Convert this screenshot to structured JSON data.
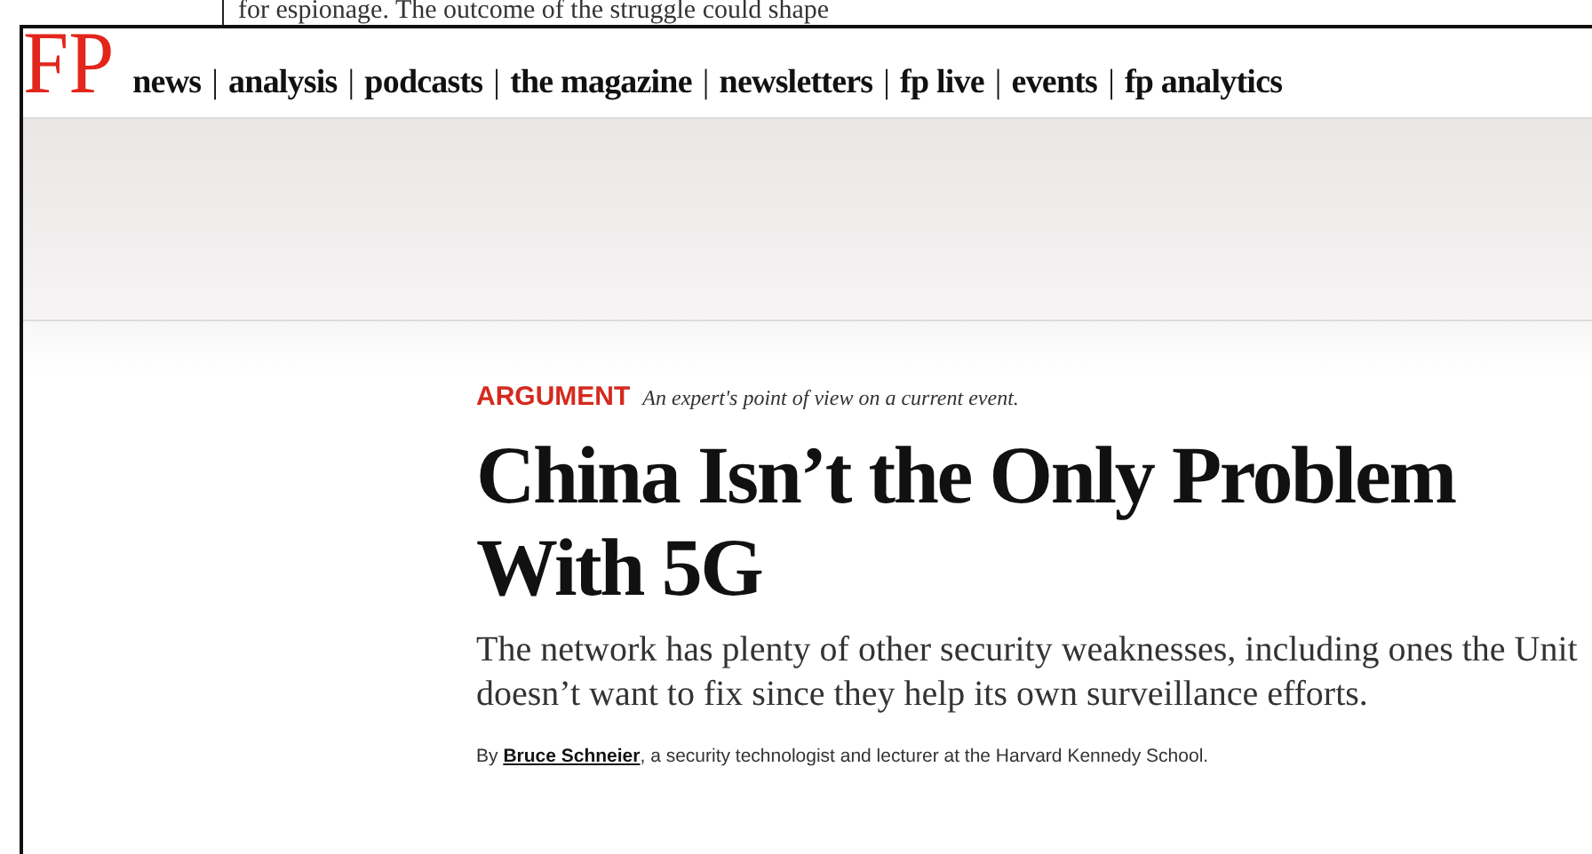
{
  "background_page": {
    "text": "for espionage. The outcome of the struggle could shape"
  },
  "header": {
    "logo": "FP",
    "separator": "|",
    "nav": [
      {
        "label": "news"
      },
      {
        "label": "analysis"
      },
      {
        "label": "podcasts"
      },
      {
        "label": "the magazine"
      },
      {
        "label": "newsletters"
      },
      {
        "label": "fp live"
      },
      {
        "label": "events"
      },
      {
        "label": "fp analytics"
      }
    ]
  },
  "article": {
    "kicker": "ARGUMENT",
    "kicker_note": "An expert's point of view on a current event.",
    "headline_lines": [
      "China Isn’t the Only Problem",
      "With 5G"
    ],
    "dek_lines": [
      "The network has plenty of other security weaknesses, including ones the Unit",
      "doesn’t want to fix since they help its own surveillance efforts."
    ],
    "byline": {
      "prefix": "By",
      "author": "Bruce Schneier",
      "rest": ", a security technologist and lecturer at the Harvard Kennedy School."
    }
  }
}
